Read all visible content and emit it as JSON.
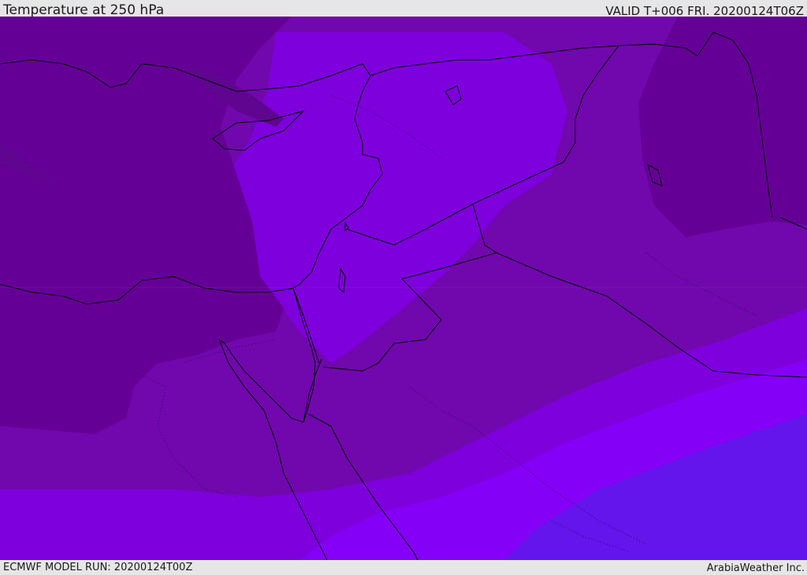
{
  "header": {
    "title": "Temperature at 250 hPa",
    "valid": "VALID T+006 FRI. 20200124T06Z"
  },
  "footer": {
    "model_run": "ECMWF MODEL RUN: 20200124T00Z",
    "credit": "ArabiaWeather Inc."
  },
  "map": {
    "field": "Temperature",
    "level": "250 hPa",
    "region": "Eastern Mediterranean / Levant / Northern Arabia",
    "palette": {
      "coldest": "#5f0590",
      "cold": "#650097",
      "mid_cold": "#7008ad",
      "mid": "#7e00dd",
      "warm": "#8500f6",
      "warmest": "#6315ec",
      "coast_line": "#000000",
      "border_line": "#000000"
    }
  }
}
